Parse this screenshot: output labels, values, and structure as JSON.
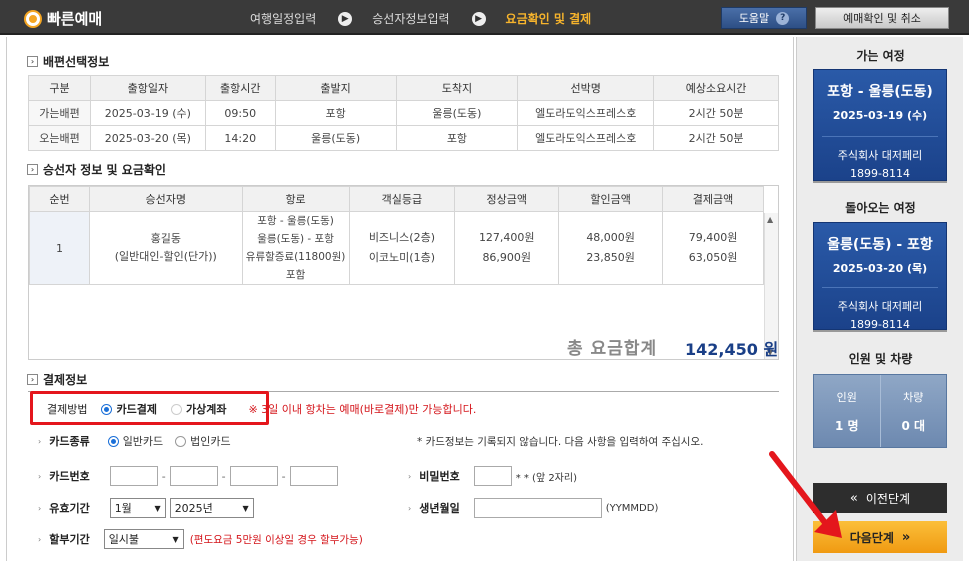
{
  "header": {
    "title": "빠른예매",
    "steps": [
      "여행일정입력",
      "승선자정보입력",
      "요금확인 및 결제"
    ],
    "help_label": "도움말",
    "help_icon": "?",
    "confirm_label": "예매확인 및 취소"
  },
  "selection": {
    "section_title": "배편선택정보",
    "columns": [
      "구분",
      "출항일자",
      "출항시간",
      "출발지",
      "도착지",
      "선박명",
      "예상소요시간"
    ],
    "rows": [
      [
        "가는배편",
        "2025-03-19 (수)",
        "09:50",
        "포항",
        "울릉(도동)",
        "엘도라도익스프레스호",
        "2시간 50분"
      ],
      [
        "오는배편",
        "2025-03-20 (목)",
        "14:20",
        "울릉(도동)",
        "포항",
        "엘도라도익스프레스호",
        "2시간 50분"
      ]
    ]
  },
  "passengers": {
    "section_title": "승선자 정보 및 요금확인",
    "columns": [
      "순번",
      "승선자명",
      "항로",
      "객실등급",
      "정상금액",
      "할인금액",
      "결제금액"
    ],
    "row": {
      "no": "1",
      "name": "홍길동",
      "type": "(일반대인-할인(단가))",
      "route1": "포항 - 울릉(도동)",
      "route2": "울릉(도동) - 포항",
      "route3": "유류할증료(11800원)포함",
      "grade1": "비즈니스(2층)",
      "grade2": "이코노미(1층)",
      "normal1": "127,400원",
      "normal2": "86,900원",
      "disc1": "48,000원",
      "disc2": "23,850원",
      "pay1": "79,400원",
      "pay2": "63,050원"
    },
    "total_label": "총 요금합계",
    "total_value": "142,450 원"
  },
  "payment": {
    "section_title": "결제정보",
    "method_label": "결제방법",
    "method_card": "카드결제",
    "method_virtual": "가상계좌",
    "method_notice": "※ 3일 이내 항차는 예매(바로결제)만 가능합니다.",
    "card_type_label": "카드종류",
    "card_personal": "일반카드",
    "card_corp": "법인카드",
    "card_notice": "* 카드정보는 기록되지 않습니다. 다음 사항을 입력하여 주십시오.",
    "card_number_label": "카드번호",
    "password_label": "비밀번호",
    "password_hint": "* * (앞 2자리)",
    "expiry_label": "유효기간",
    "expiry_month": "1월",
    "expiry_year": "2025년",
    "birth_label": "생년월일",
    "birth_hint": "(YYMMDD)",
    "installment_label": "할부기간",
    "installment_value": "일시불",
    "installment_notice": "(편도요금 5만원 이상일 경우 할부가능)"
  },
  "side": {
    "outbound_head": "가는 여정",
    "outbound_route": "포항 - 울릉(도동)",
    "outbound_date": "2025-03-19 (수)",
    "outbound_company": "주식회사 대저페리",
    "outbound_tel": "1899-8114",
    "return_head": "돌아오는 여정",
    "return_route": "울릉(도동) - 포항",
    "return_date": "2025-03-20 (목)",
    "return_company": "주식회사 대저페리",
    "return_tel": "1899-8114",
    "people_head": "인원 및 차량",
    "people_label": "인원",
    "people_value": "1 명",
    "vehicle_label": "차량",
    "vehicle_value": "0 대",
    "prev_label": "이전단계",
    "next_label": "다음단계"
  },
  "colors": {
    "accent": "#f7b42c",
    "card_blue": "#1b428a",
    "highlight_red": "#e4161c"
  }
}
